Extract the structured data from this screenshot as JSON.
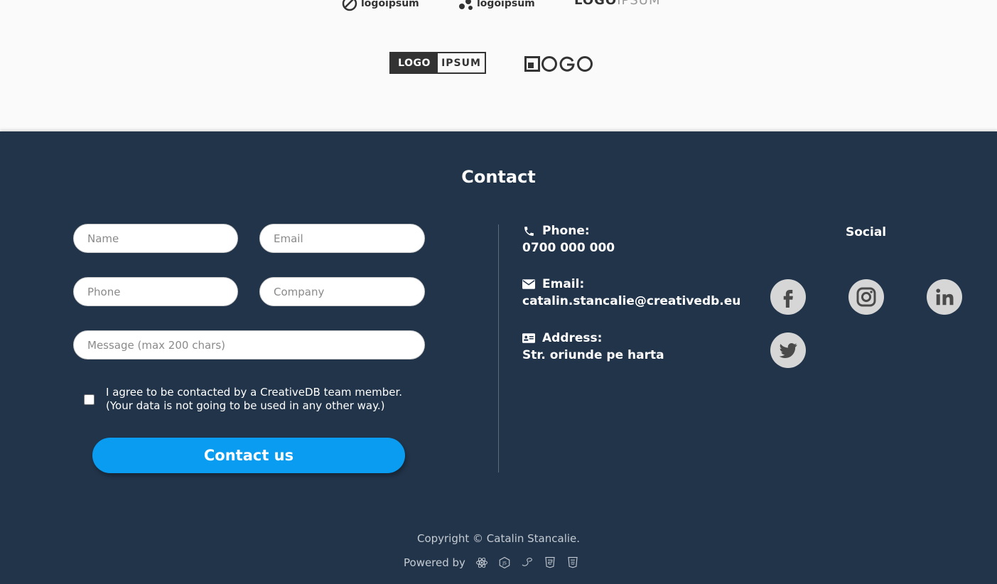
{
  "logos": {
    "logo1": "logoipsum",
    "logo2": "logoipsum",
    "logo3_bold": "LOGO",
    "logo3_light": "IPSUM",
    "logo4_a": "LOGO",
    "logo4_b": "IPSUM",
    "logo5": "LOGO"
  },
  "contact": {
    "title": "Contact",
    "form": {
      "name_placeholder": "Name",
      "email_placeholder": "Email",
      "phone_placeholder": "Phone",
      "company_placeholder": "Company",
      "message_placeholder": "Message (max 200 chars)",
      "agree_line1": "I agree to be contacted by a CreativeDB team member.",
      "agree_line2": "(Your data is not going to be used in any other way.)",
      "submit_label": "Contact us"
    },
    "info": {
      "phone_label": "Phone:",
      "phone_value": "0700 000 000",
      "email_label": "Email:",
      "email_value": "catalin.stancalie@creativedb.eu",
      "address_label": "Address:",
      "address_value": "Str. oriunde pe harta"
    },
    "social": {
      "title": "Social",
      "icons": [
        "facebook-icon",
        "instagram-icon",
        "linkedin-icon",
        "twitter-icon"
      ]
    }
  },
  "footer": {
    "copyright": "Copyright © Catalin Stancalie.",
    "powered_by": "Powered by",
    "tech_icons": [
      "react-icon",
      "nodejs-icon",
      "sass-icon",
      "html5-icon",
      "css3-icon"
    ]
  },
  "colors": {
    "footer_bg": "#22344a",
    "button": "#0a9cf0",
    "social_bg": "#d6d6d6"
  }
}
